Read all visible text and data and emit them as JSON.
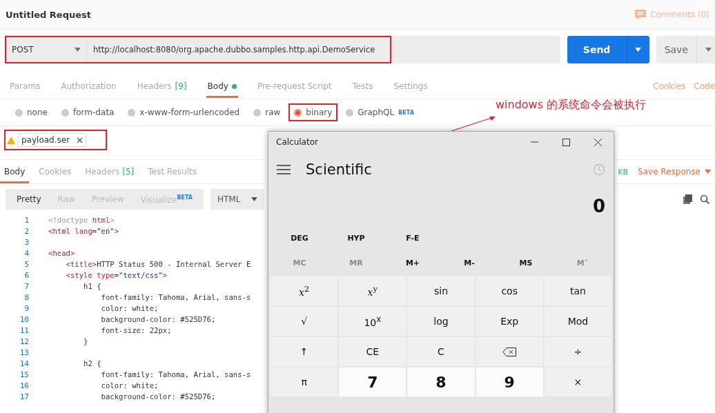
{
  "header": {
    "title": "Untitled Request",
    "comments": "Comments (0)"
  },
  "request": {
    "method": "POST",
    "url": "http://localhost:8080/org.apache.dubbo.samples.http.api.DemoService",
    "highlighted": true,
    "send": "Send",
    "save": "Save"
  },
  "tabs": [
    {
      "label": "Params",
      "selected": false,
      "dot": false
    },
    {
      "label": "Authorization",
      "selected": false,
      "dot": false
    },
    {
      "label": "Headers",
      "count": "[9]",
      "selected": false,
      "dot": false
    },
    {
      "label": "Body",
      "selected": true,
      "dot": true
    },
    {
      "label": "Pre-request Script",
      "selected": false,
      "dot": false
    },
    {
      "label": "Tests",
      "selected": false,
      "dot": false
    },
    {
      "label": "Settings",
      "selected": false,
      "dot": false
    }
  ],
  "tab_links": [
    "Cookies",
    "Code"
  ],
  "body_types": [
    {
      "label": "none",
      "selected": false,
      "highlighted": false
    },
    {
      "label": "form-data",
      "selected": false,
      "highlighted": false
    },
    {
      "label": "x-www-form-urlencoded",
      "selected": false,
      "highlighted": false
    },
    {
      "label": "raw",
      "selected": false,
      "highlighted": false
    },
    {
      "label": "binary",
      "selected": true,
      "highlighted": true
    },
    {
      "label": "GraphQL",
      "badge": "BETA",
      "selected": false,
      "highlighted": false
    }
  ],
  "file": {
    "name": "payload.ser",
    "highlighted": true
  },
  "annotation": {
    "text": "windows 的系统命令会被执行"
  },
  "response_tabs": [
    {
      "label": "Body",
      "selected": true
    },
    {
      "label": "Cookies",
      "selected": false
    },
    {
      "label": "Headers",
      "count": "[5]",
      "selected": false
    },
    {
      "label": "Test Results",
      "selected": false
    }
  ],
  "response_meta": {
    "size": "KB",
    "save": "Save Response"
  },
  "views": [
    {
      "label": "Pretty",
      "selected": true
    },
    {
      "label": "Raw",
      "selected": false
    },
    {
      "label": "Preview",
      "selected": false
    },
    {
      "label": "Visualize",
      "badge": "BETA",
      "selected": false
    }
  ],
  "format": "HTML",
  "code": [
    {
      "n": "1",
      "segs": [
        {
          "kind": "punct",
          "text": "<!doctype "
        },
        {
          "kind": "attr",
          "text": "html"
        },
        {
          "kind": "punct",
          "text": ">"
        }
      ]
    },
    {
      "n": "2",
      "segs": [
        {
          "kind": "tag",
          "text": "<html "
        },
        {
          "kind": "attr",
          "text": "lang"
        },
        {
          "kind": "plain",
          "text": "="
        },
        {
          "kind": "str",
          "text": "\"en\""
        },
        {
          "kind": "tag",
          "text": ">"
        }
      ]
    },
    {
      "n": "3"
    },
    {
      "n": "4",
      "segs": [
        {
          "kind": "tag",
          "text": "<head>"
        }
      ]
    },
    {
      "n": "5",
      "segs": [
        {
          "kind": "tag",
          "text": "    <title>"
        },
        {
          "kind": "plain",
          "text": "HTTP Status 500 - Internal Server E"
        }
      ]
    },
    {
      "n": "6",
      "segs": [
        {
          "kind": "tag",
          "text": "    <style "
        },
        {
          "kind": "attr",
          "text": "type"
        },
        {
          "kind": "plain",
          "text": "="
        },
        {
          "kind": "str",
          "text": "\"text/css\""
        },
        {
          "kind": "tag",
          "text": ">"
        }
      ]
    },
    {
      "n": "7",
      "segs": [
        {
          "kind": "plain",
          "text": "        h1 {"
        }
      ]
    },
    {
      "n": "8",
      "segs": [
        {
          "kind": "plain",
          "text": "            font-family: Tahoma, Arial, sans-s"
        }
      ]
    },
    {
      "n": "9",
      "segs": [
        {
          "kind": "plain",
          "text": "            color: white;"
        }
      ]
    },
    {
      "n": "10",
      "segs": [
        {
          "kind": "plain",
          "text": "            background-color: #525D76;"
        }
      ]
    },
    {
      "n": "11",
      "segs": [
        {
          "kind": "plain",
          "text": "            font-size: 22px;"
        }
      ]
    },
    {
      "n": "12",
      "segs": [
        {
          "kind": "plain",
          "text": "        }"
        }
      ]
    },
    {
      "n": "13"
    },
    {
      "n": "14",
      "segs": [
        {
          "kind": "plain",
          "text": "        h2 {"
        }
      ]
    },
    {
      "n": "15",
      "segs": [
        {
          "kind": "plain",
          "text": "            font-family: Tahoma, Arial, sans-s"
        }
      ]
    },
    {
      "n": "16",
      "segs": [
        {
          "kind": "plain",
          "text": "            color: white;"
        }
      ]
    },
    {
      "n": "17",
      "segs": [
        {
          "kind": "plain",
          "text": "            background-color: #525D76;"
        }
      ]
    }
  ],
  "calculator": {
    "title": "Calculator",
    "mode": "Scientific",
    "display": "0",
    "modes": [
      "DEG",
      "HYP",
      "F-E"
    ],
    "memory": [
      {
        "label": "MC",
        "disabled": true
      },
      {
        "label": "MR",
        "disabled": true
      },
      {
        "label": "M+",
        "disabled": false
      },
      {
        "label": "M-",
        "disabled": false
      },
      {
        "label": "MS",
        "disabled": false
      },
      {
        "label": "M˅",
        "disabled": true
      }
    ],
    "keys": [
      {
        "kind": "math",
        "label": "*x*$^{2}$"
      },
      {
        "kind": "math",
        "label": "*x*$^{y}$"
      },
      {
        "kind": "fn",
        "label": "sin"
      },
      {
        "kind": "fn",
        "label": "cos"
      },
      {
        "kind": "fn",
        "label": "tan"
      },
      {
        "kind": "fn",
        "label": "√"
      },
      {
        "kind": "fn",
        "label": "10$^{x}$"
      },
      {
        "kind": "fn",
        "label": "log"
      },
      {
        "kind": "fn",
        "label": "Exp"
      },
      {
        "kind": "fn",
        "label": "Mod"
      },
      {
        "kind": "fn",
        "label": "↑"
      },
      {
        "kind": "fn",
        "label": "CE"
      },
      {
        "kind": "fn",
        "label": "C"
      },
      {
        "kind": "backspace"
      },
      {
        "kind": "fn",
        "label": "÷"
      },
      {
        "kind": "fn",
        "label": "π"
      },
      {
        "kind": "digit",
        "label": "7"
      },
      {
        "kind": "digit",
        "label": "8"
      },
      {
        "kind": "digit",
        "label": "9"
      },
      {
        "kind": "fn",
        "label": "×"
      }
    ]
  }
}
